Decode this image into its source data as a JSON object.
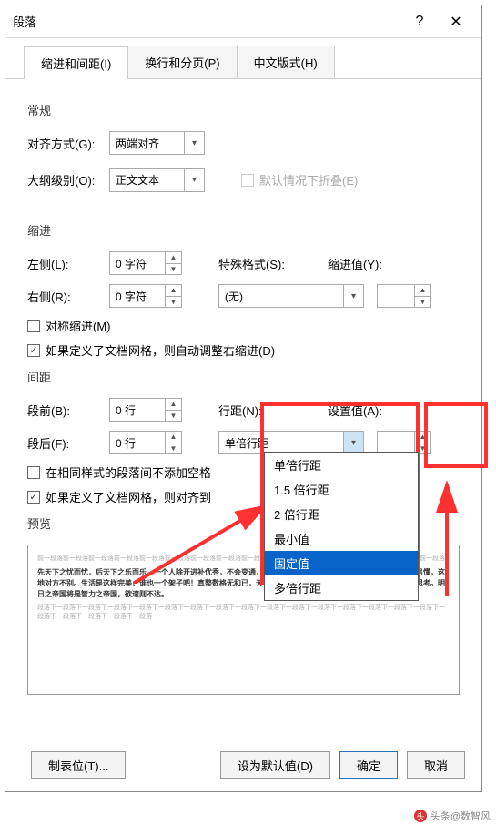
{
  "titlebar": {
    "title": "段落"
  },
  "tabs": {
    "t1": "缩进和间距(I)",
    "t2": "换行和分页(P)",
    "t3": "中文版式(H)"
  },
  "sections": {
    "general": "常规",
    "indent": "缩进",
    "spacing": "间距",
    "preview": "预览"
  },
  "general": {
    "align_label": "对齐方式(G):",
    "align_value": "两端对齐",
    "outline_label": "大纲级别(O):",
    "outline_value": "正文文本",
    "collapse_label": "默认情况下折叠(E)"
  },
  "indent": {
    "left_label": "左侧(L):",
    "left_value": "0 字符",
    "right_label": "右侧(R):",
    "right_value": "0 字符",
    "special_label": "特殊格式(S):",
    "special_value": "(无)",
    "by_label": "缩进值(Y):",
    "by_value": "",
    "mirror_label": "对称缩进(M)",
    "grid_label": "如果定义了文档网格，则自动调整右缩进(D)"
  },
  "spacing": {
    "before_label": "段前(B):",
    "before_value": "0 行",
    "after_label": "段后(F):",
    "after_value": "0 行",
    "line_label": "行距(N):",
    "line_value": "单倍行距",
    "at_label": "设置值(A):",
    "at_value": "",
    "noadd_label": "在相同样式的段落间不添加空格",
    "grid_label": "如果定义了文档网格，则对齐到"
  },
  "line_options": [
    "单倍行距",
    "1.5 倍行距",
    "2 倍行距",
    "最小值",
    "固定值",
    "多倍行距"
  ],
  "line_selected": "固定值",
  "preview_gray": "前一段落前一段落前一段落前一段落前一段落前一段落前一段落前一段落前一段落前一段落前一段落前一段落前一段落前一段落前一段落前一段落",
  "preview_text": "先天下之忧而忧，后天下之乐而乐。一个人除开进补优秀，不会变通，够够一事无成，要我往会落的字档，它采得他实易懂，这地对方不别。生活是这样完美，谁也一个架子吧！真整数格无和已，天下谁人不识君。学习知识要善于思考，思考，再思考。明日之帝国将是智力之帝国，欲速则不达。",
  "preview_gray2": "段落下一段落下一段落下一段落下一段落下一段落下一段落下一段落下一段落下一段落下一段落下一段落下一段落下一段落下一段落下一段落下一段落下一段落下一段落下一段落下一段落",
  "footer": {
    "tabs": "制表位(T)...",
    "default": "设为默认值(D)",
    "ok": "确定",
    "cancel": "取消"
  },
  "watermark": "头条@数智风"
}
